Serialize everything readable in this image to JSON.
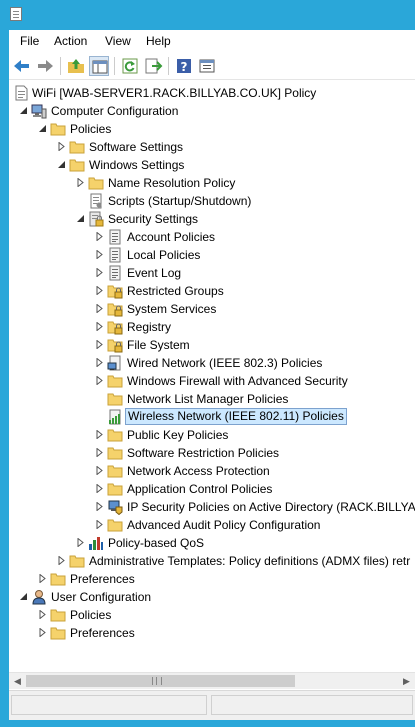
{
  "menu": {
    "file": "File",
    "action": "Action",
    "view": "View",
    "help": "Help"
  },
  "toolbar": {
    "back": "back-arrow-icon",
    "forward": "forward-arrow-icon",
    "up": "up-folder-icon",
    "show_hide_tree": "console-tree-icon",
    "refresh": "refresh-icon",
    "export": "export-list-icon",
    "help": "help-icon",
    "properties": "properties-icon"
  },
  "tree": {
    "root": "WiFi [WAB-SERVER1.RACK.BILLYAB.CO.UK] Policy",
    "computer_configuration": "Computer Configuration",
    "cc_policies": "Policies",
    "software_settings": "Software Settings",
    "windows_settings": "Windows Settings",
    "name_resolution_policy": "Name Resolution Policy",
    "scripts": "Scripts (Startup/Shutdown)",
    "security_settings": "Security Settings",
    "account_policies": "Account Policies",
    "local_policies": "Local Policies",
    "event_log": "Event Log",
    "restricted_groups": "Restricted Groups",
    "system_services": "System Services",
    "registry": "Registry",
    "file_system": "File System",
    "wired_network": "Wired Network (IEEE 802.3) Policies",
    "windows_firewall": "Windows Firewall with Advanced Security",
    "network_list_manager": "Network List Manager Policies",
    "wireless_network": "Wireless Network (IEEE 802.11) Policies",
    "public_key_policies": "Public Key Policies",
    "software_restriction": "Software Restriction Policies",
    "network_access_protection": "Network Access Protection",
    "application_control": "Application Control Policies",
    "ip_security": "IP Security Policies on Active Directory (RACK.BILLYAB",
    "advanced_audit": "Advanced Audit Policy Configuration",
    "policy_based_qos": "Policy-based QoS",
    "administrative_templates": "Administrative Templates: Policy definitions (ADMX files) retr",
    "cc_preferences": "Preferences",
    "user_configuration": "User Configuration",
    "uc_policies": "Policies",
    "uc_preferences": "Preferences"
  },
  "scrollbar": {
    "left_arrow": "◀",
    "right_arrow": "▶"
  },
  "colors": {
    "title_bar": "#2aa7d9",
    "selection": "#cce8ff",
    "folder": "#f5d26b"
  }
}
